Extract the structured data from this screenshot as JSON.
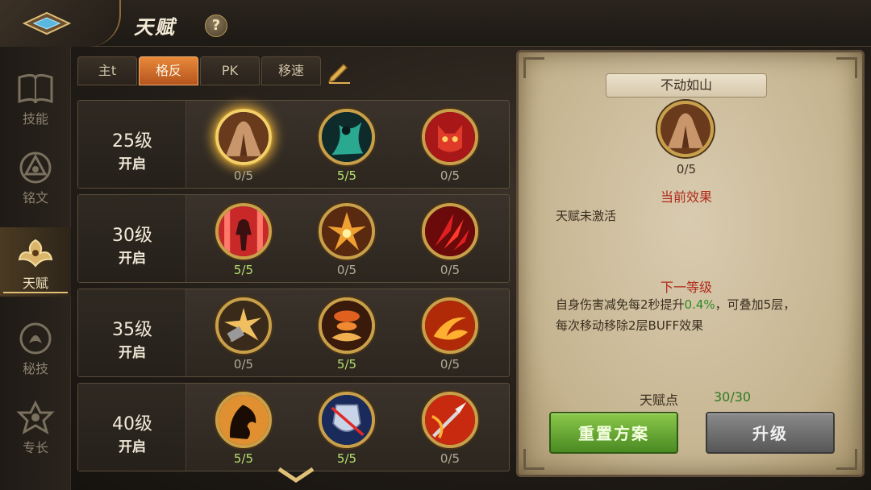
{
  "header": {
    "title": "天赋",
    "help_glyph": "?"
  },
  "sidebar": {
    "items": [
      {
        "label": "技能",
        "icon": "book-icon",
        "active": false
      },
      {
        "label": "铭文",
        "icon": "rune-icon",
        "active": false
      },
      {
        "label": "天赋",
        "icon": "talent-icon",
        "active": true
      },
      {
        "label": "秘技",
        "icon": "secret-icon",
        "active": false
      },
      {
        "label": "专长",
        "icon": "specialty-icon",
        "active": false
      }
    ]
  },
  "tabs": [
    {
      "label": "主t",
      "active": false
    },
    {
      "label": "格反",
      "active": true
    },
    {
      "label": "PK",
      "active": false
    },
    {
      "label": "移速",
      "active": false
    }
  ],
  "tiers": [
    {
      "level": "25级",
      "open": "开启",
      "talents": [
        {
          "icon": "mountain-icon",
          "count": "0/5",
          "selected": true
        },
        {
          "icon": "figure-icon",
          "count": "5/5",
          "selected": false
        },
        {
          "icon": "demon-face-icon",
          "count": "0/5",
          "selected": false
        }
      ]
    },
    {
      "level": "30级",
      "open": "开启",
      "talents": [
        {
          "icon": "warrior-icon",
          "count": "5/5",
          "selected": false
        },
        {
          "icon": "fire-burst-icon",
          "count": "0/5",
          "selected": false
        },
        {
          "icon": "claw-icon",
          "count": "0/5",
          "selected": false
        }
      ]
    },
    {
      "level": "35级",
      "open": "开启",
      "talents": [
        {
          "icon": "explosion-icon",
          "count": "0/5",
          "selected": false
        },
        {
          "icon": "vortex-icon",
          "count": "5/5",
          "selected": false
        },
        {
          "icon": "flame-swirl-icon",
          "count": "0/5",
          "selected": false
        }
      ]
    },
    {
      "level": "40级",
      "open": "开启",
      "talents": [
        {
          "icon": "shadow-icon",
          "count": "5/5",
          "selected": false
        },
        {
          "icon": "shield-icon",
          "count": "5/5",
          "selected": false
        },
        {
          "icon": "spear-icon",
          "count": "0/5",
          "selected": false
        }
      ]
    }
  ],
  "detail": {
    "name": "不动如山",
    "count": "0/5",
    "current_title": "当前效果",
    "current_text": "天赋未激活",
    "next_title": "下一等级",
    "next_text_a": "自身伤害减免每2秒提升",
    "next_text_hl": "0.4%",
    "next_text_b": "，可叠加5层，",
    "next_text_c": "每次移动移除2层BUFF效果",
    "points_label": "天赋点",
    "points_value": "30/30",
    "reset_label": "重置方案",
    "upgrade_label": "升级"
  },
  "colors": {
    "accent": "#e8893a",
    "full_count": "#b6e070",
    "effect_title": "#b02a1a",
    "highlight": "#2e8a24"
  }
}
